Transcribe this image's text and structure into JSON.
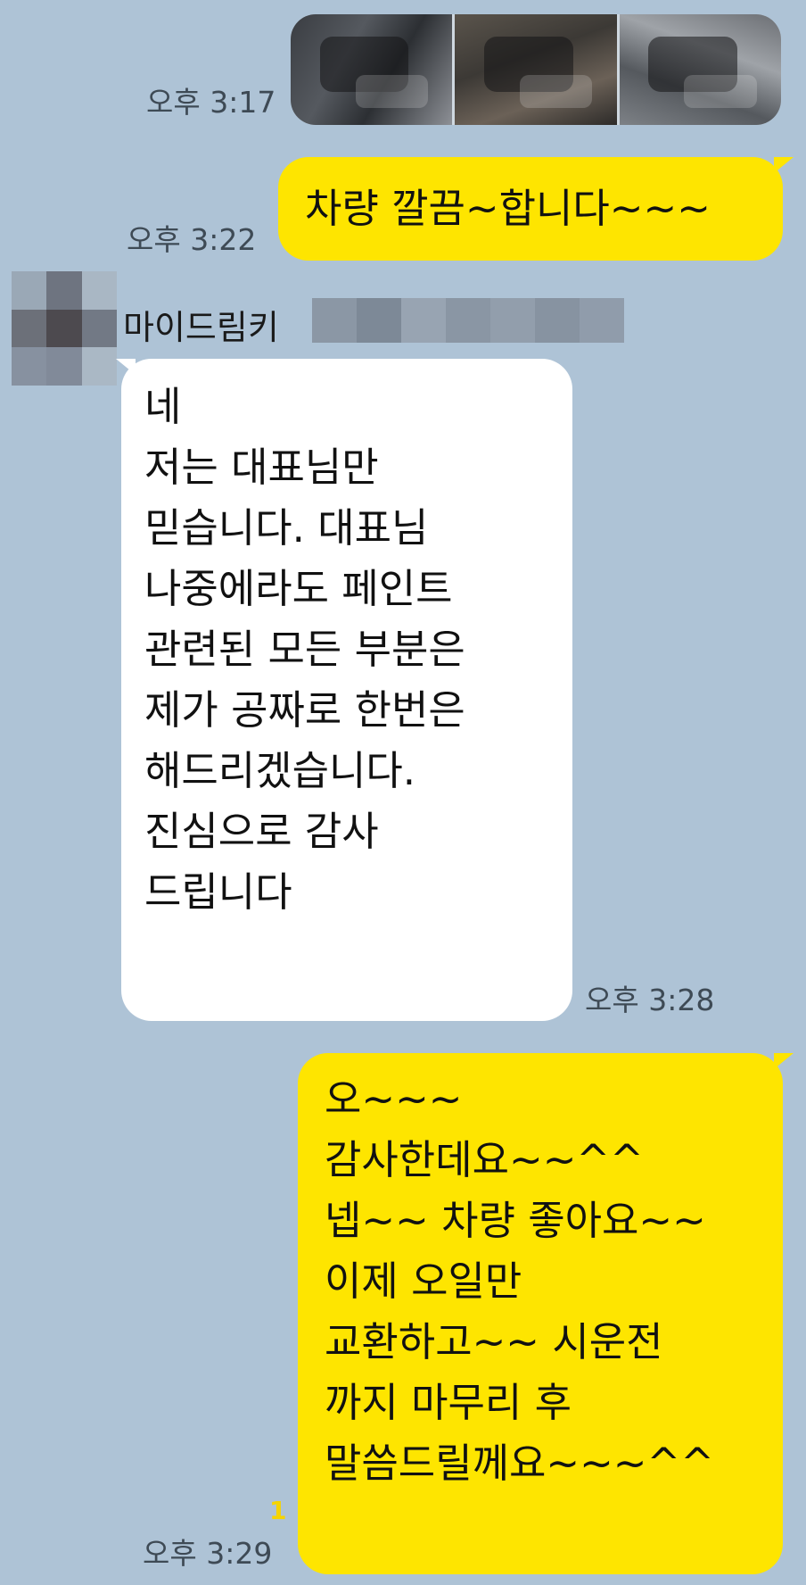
{
  "messages": {
    "photos": {
      "time": "오후 3:17",
      "count": 3
    },
    "msg1": {
      "text": "차량 깔끔~합니다~~~",
      "time": "오후 3:22"
    },
    "sender": {
      "name": "마이드림키"
    },
    "msg2": {
      "lines": [
        "네",
        "저는 대표님만",
        "믿습니다.  대표님",
        "나중에라도 페인트",
        "관련된 모든 부분은",
        "제가 공짜로 한번은",
        "해드리겠습니다.",
        "진심으로 감사",
        "드립니다"
      ],
      "time": "오후 3:28"
    },
    "msg3": {
      "lines": [
        "오~~~",
        "감사한데요~~^^",
        "넵~~ 차량 좋아요~~",
        "이제 오일만",
        "교환하고~~ 시운전",
        "까지 마무리 후",
        "말씀드릴께요~~~^^"
      ],
      "time": "오후 3:29",
      "unread": "1"
    }
  },
  "colors": {
    "background": "#aec3d6",
    "my_bubble": "#fee500",
    "their_bubble": "#ffffff",
    "unread": "#f5d400"
  }
}
